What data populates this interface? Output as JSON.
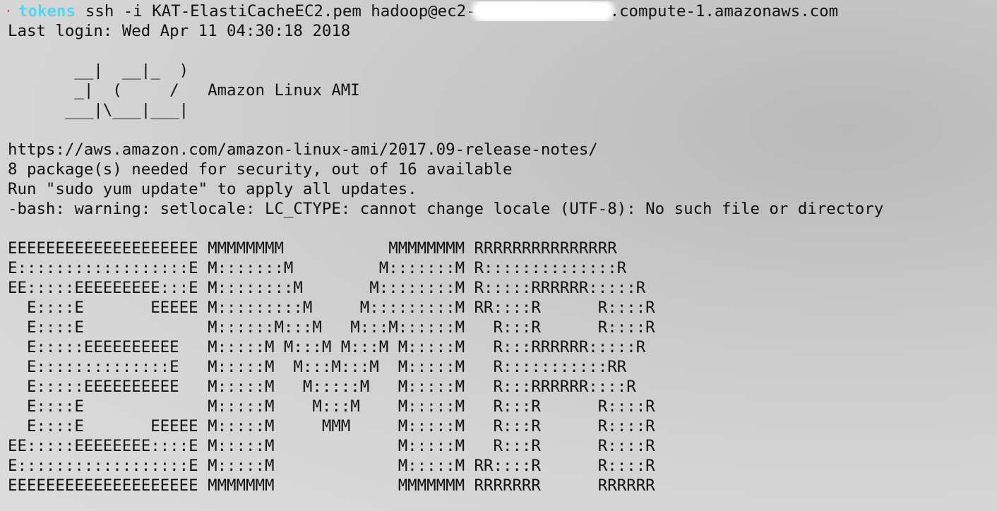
{
  "prompt": {
    "arrow": "➜",
    "directory": "tokens",
    "command_before": "ssh -i KAT-ElastiCacheEC2.pem hadoop@ec2-",
    "command_after": ".compute-1.amazonaws.com"
  },
  "last_login": "Last login: Wed Apr 11 04:30:18 2018",
  "ami_banner": [
    "       __|  __|_  )",
    "       _|  (     /   Amazon Linux AMI",
    "      ___|\\___|___|"
  ],
  "motd": [
    "https://aws.amazon.com/amazon-linux-ami/2017.09-release-notes/",
    "8 package(s) needed for security, out of 16 available",
    "Run \"sudo yum update\" to apply all updates.",
    "-bash: warning: setlocale: LC_CTYPE: cannot change locale (UTF-8): No such file or directory"
  ],
  "emr_banner": [
    "EEEEEEEEEEEEEEEEEEEE MMMMMMMM           MMMMMMMM RRRRRRRRRRRRRRR",
    "E::::::::::::::::::E M:::::::M         M:::::::M R::::::::::::::R",
    "EE:::::EEEEEEEEE:::E M::::::::M       M::::::::M R:::::RRRRRR:::::R",
    "  E::::E       EEEEE M:::::::::M     M:::::::::M RR::::R      R::::R",
    "  E::::E             M::::::M:::M   M:::M::::::M   R:::R      R::::R",
    "  E:::::EEEEEEEEEE   M:::::M M:::M M:::M M:::::M   R:::RRRRRR:::::R",
    "  E::::::::::::::E   M:::::M  M:::M:::M  M:::::M   R:::::::::::RR",
    "  E:::::EEEEEEEEEE   M:::::M   M:::::M   M:::::M   R:::RRRRRR::::R",
    "  E::::E             M:::::M    M:::M    M:::::M   R:::R      R::::R",
    "  E::::E       EEEEE M:::::M     MMM     M:::::M   R:::R      R::::R",
    "EE:::::EEEEEEEE::::E M:::::M             M:::::M   R:::R      R::::R",
    "E::::::::::::::::::E M:::::M             M:::::M RR::::R      R::::R",
    "EEEEEEEEEEEEEEEEEEEE MMMMMMM             MMMMMMM RRRRRRR      RRRRRR"
  ]
}
